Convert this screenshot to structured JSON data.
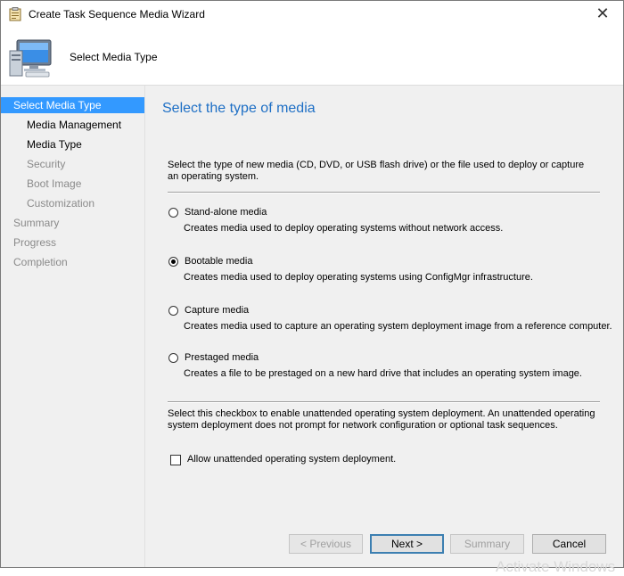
{
  "window": {
    "title": "Create Task Sequence Media Wizard",
    "close_glyph": "✕"
  },
  "header": {
    "title": "Select Media Type",
    "icon": "computer-icon"
  },
  "sidebar": {
    "items": [
      {
        "label": "Select Media Type",
        "state": "active"
      },
      {
        "label": "Media Management",
        "state": "done"
      },
      {
        "label": "Media Type",
        "state": "done"
      },
      {
        "label": "Security",
        "state": "pending"
      },
      {
        "label": "Boot Image",
        "state": "pending"
      },
      {
        "label": "Customization",
        "state": "pending"
      },
      {
        "label": "Summary",
        "state": "pending"
      },
      {
        "label": "Progress",
        "state": "pending"
      },
      {
        "label": "Completion",
        "state": "pending"
      }
    ]
  },
  "main": {
    "heading": "Select the type of media",
    "description": "Select the type of new media (CD, DVD, or USB flash drive) or the file used to deploy or capture an operating system.",
    "options": [
      {
        "label": "Stand-alone media",
        "description": "Creates media used to deploy operating systems without network access.",
        "checked": false
      },
      {
        "label": "Bootable media",
        "description": "Creates media used to deploy operating systems using ConfigMgr infrastructure.",
        "checked": true
      },
      {
        "label": "Capture media",
        "description": "Creates media used to capture an operating system deployment image from a reference computer.",
        "checked": false
      },
      {
        "label": "Prestaged media",
        "description": "Creates a file to be prestaged on a new hard drive that includes an operating system image.",
        "checked": false
      }
    ],
    "unattended_description": "Select this checkbox to enable unattended operating system deployment. An unattended operating system deployment does not prompt for network configuration or optional task sequences.",
    "unattended_checkbox_label": "Allow unattended operating system deployment.",
    "unattended_checked": false
  },
  "footer": {
    "previous_label": "< Previous",
    "next_label": "Next >",
    "summary_label": "Summary",
    "cancel_label": "Cancel"
  },
  "watermark": "Activate Windows",
  "colors": {
    "accent": "#3399ff",
    "heading": "#1e6fc5",
    "panel_bg": "#f0f0f0"
  }
}
